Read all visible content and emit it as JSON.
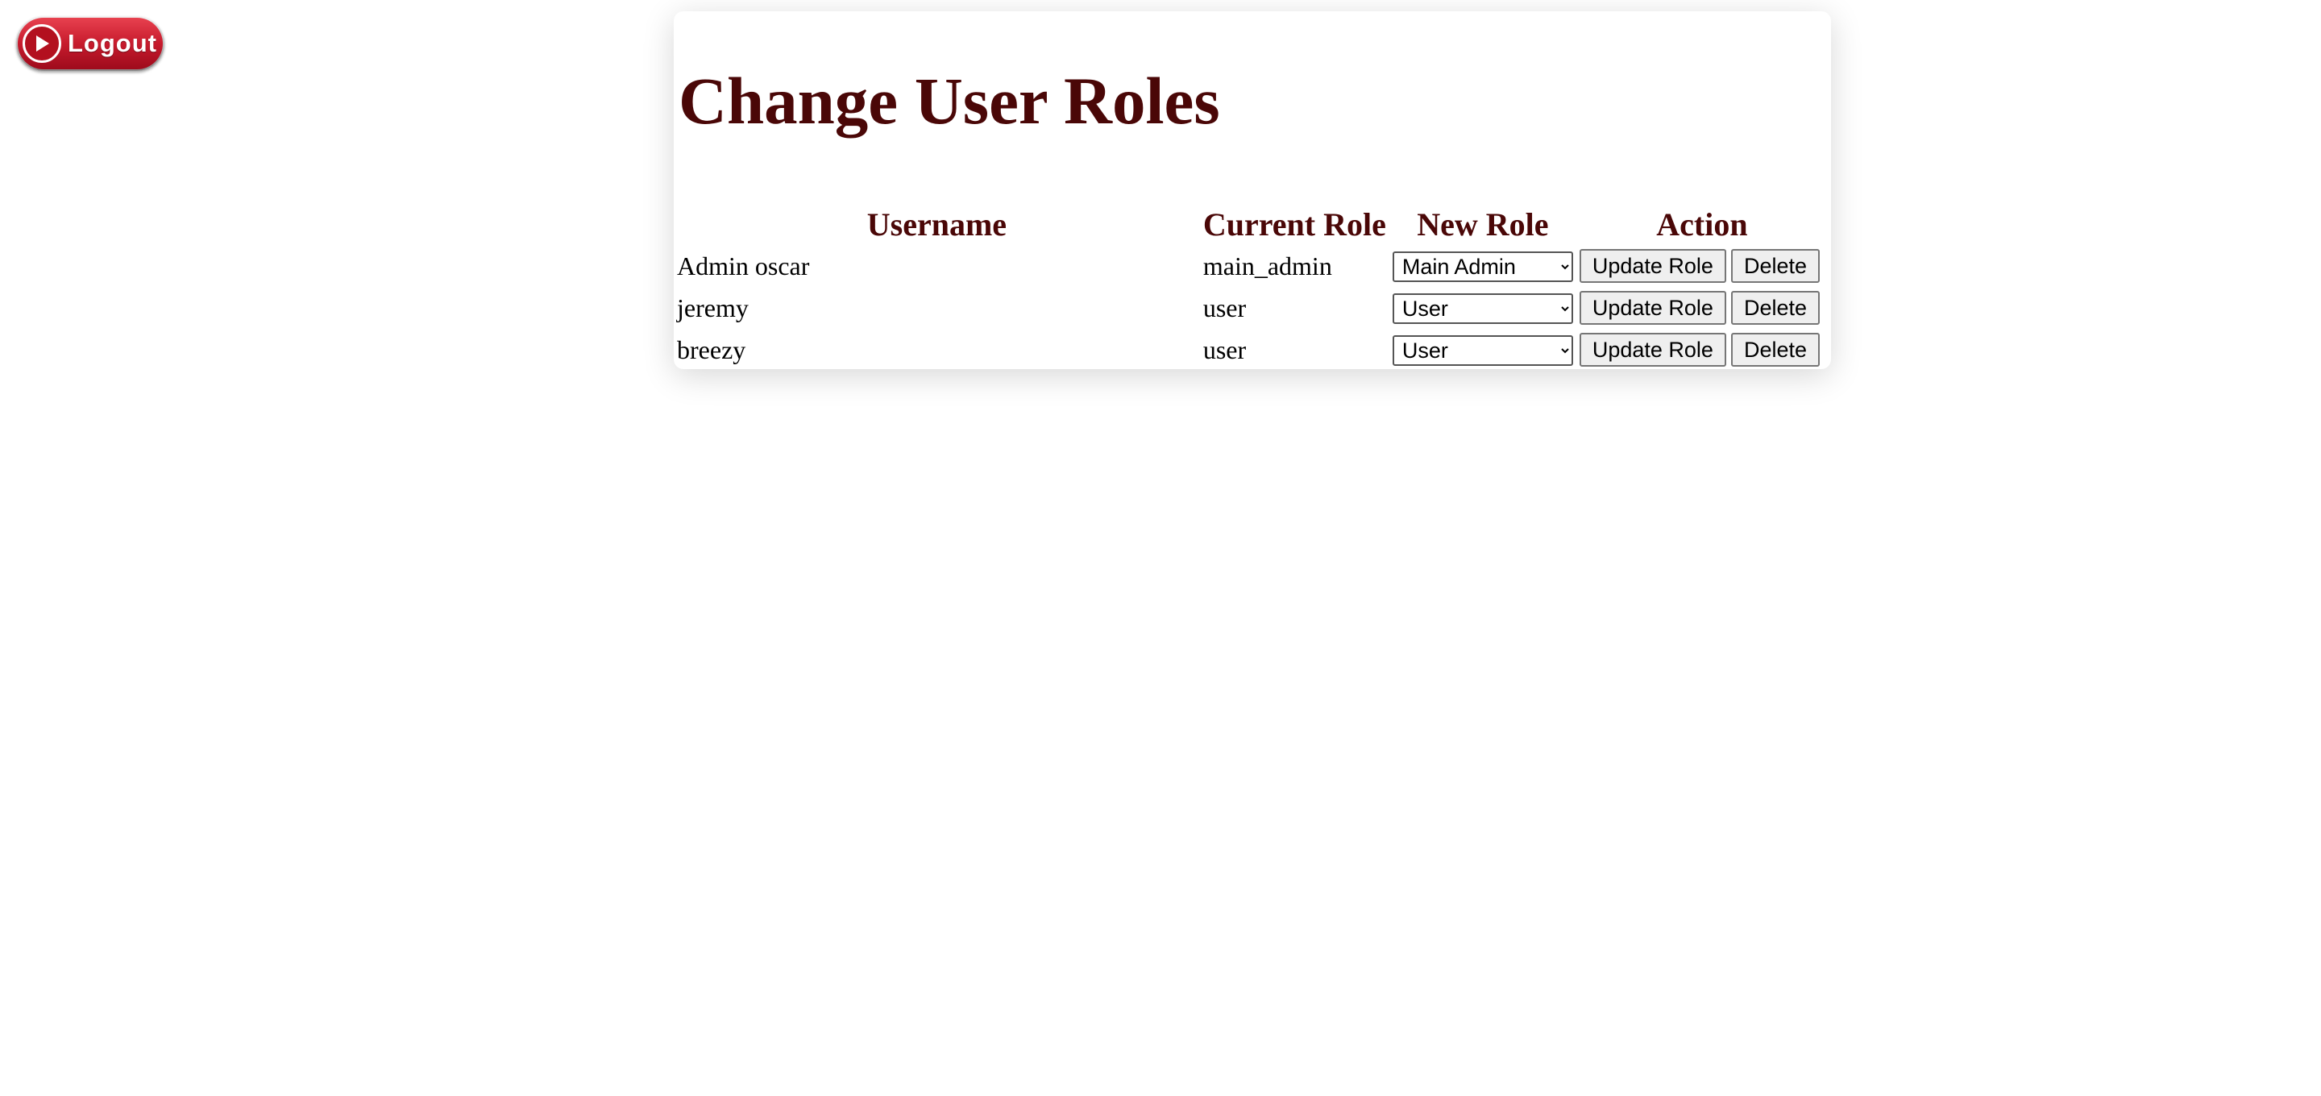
{
  "header": {
    "logout_label": "Logout"
  },
  "main": {
    "title": "Change User Roles",
    "columns": {
      "username": "Username",
      "current_role": "Current Role",
      "new_role": "New Role",
      "action": "Action"
    },
    "rows": [
      {
        "username": "Admin oscar",
        "current_role": "main_admin",
        "new_role_selected": "Main Admin",
        "update_label": "Update Role",
        "delete_label": "Delete"
      },
      {
        "username": "jeremy",
        "current_role": "user",
        "new_role_selected": "User",
        "update_label": "Update Role",
        "delete_label": "Delete"
      },
      {
        "username": "breezy",
        "current_role": "user",
        "new_role_selected": "User",
        "update_label": "Update Role",
        "delete_label": "Delete"
      }
    ]
  },
  "colors": {
    "heading": "#4a0707",
    "logout_red": "#c71b2d"
  },
  "icons": {
    "logout": "play-circle-icon",
    "select": "chevron-down-icon"
  }
}
